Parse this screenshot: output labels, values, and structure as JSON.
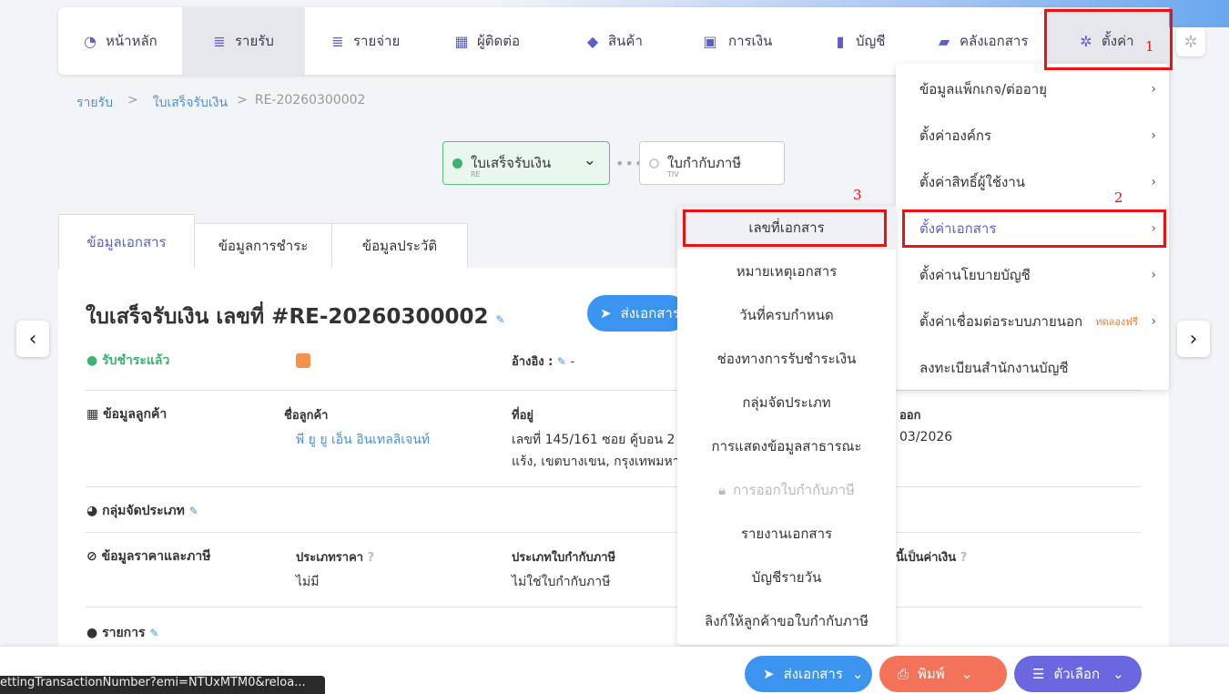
{
  "nav": {
    "items": [
      {
        "label": "หน้าหลัก",
        "icon": "dashboard-icon"
      },
      {
        "label": "รายรับ",
        "icon": "income-icon"
      },
      {
        "label": "รายจ่าย",
        "icon": "expense-icon"
      },
      {
        "label": "ผู้ติดต่อ",
        "icon": "building-icon"
      },
      {
        "label": "สินค้า",
        "icon": "box-icon"
      },
      {
        "label": "การเงิน",
        "icon": "money-icon"
      },
      {
        "label": "บัญชี",
        "icon": "book-icon"
      },
      {
        "label": "คลังเอกสาร",
        "icon": "folder-icon"
      },
      {
        "label": "ตั้งค่า",
        "icon": "gear-icon"
      }
    ]
  },
  "annotations": {
    "n1": "1",
    "n2": "2",
    "n3": "3"
  },
  "breadcrumb": {
    "c1": "รายรับ",
    "sep": ">",
    "c2": "ใบเสร็จรับเงิน",
    "c3": "RE-20260300002"
  },
  "flow": {
    "step1_title": "ใบเสร็จรับเงิน",
    "step1_sub": "RE",
    "step2_title": "ใบกำกับภาษี",
    "step2_sub": "TIV",
    "dots": "•••"
  },
  "tabs": [
    "ข้อมูลเอกสาร",
    "ข้อมูลการชำระ",
    "ข้อมูลประวัติ"
  ],
  "doc": {
    "title": "ใบเสร็จรับเงิน เลขที่ #RE-20260300002",
    "send_label": "ส่งเอกสาร",
    "status": "รับชำระแล้ว",
    "reference_label": "อ้างอิง :",
    "reference_value": "-",
    "customer_section": "ข้อมูลลูกค้า",
    "customer_name_label": "ชื่อลูกค้า",
    "customer_name": "พี ยู ยู เอ็น อินเทลลิเจนท์",
    "address_label": "ที่อยู่",
    "address_line1": "เลขที่ 145/161 ซอย คู้บอน 2",
    "address_line2": "แร้ง, เขตบางเขน, กรุงเทพมหา",
    "issue_date_label": "ออก",
    "issue_date": "03/2026",
    "category_section": "กลุ่มจัดประเภท",
    "price_section": "ข้อมูลราคาและภาษี",
    "price_type_label": "ประเภทราคา",
    "price_type_value": "ไม่มี",
    "tax_inv_type_label": "ประเภทใบกำกับภาษี",
    "tax_inv_type_value": "ไม่ใช่ใบกำกับภาษี",
    "currency_label": "นี้เป็นค่าเงิน",
    "items_section": "รายการ"
  },
  "settings_menu": [
    {
      "label": "ข้อมูลแพ็กเกจ/ต่ออายุ",
      "badge": ""
    },
    {
      "label": "ตั้งค่าองค์กร",
      "badge": ""
    },
    {
      "label": "ตั้งค่าสิทธิ์ผู้ใช้งาน",
      "badge": ""
    },
    {
      "label": "ตั้งค่าเอกสาร",
      "badge": ""
    },
    {
      "label": "ตั้งค่านโยบายบัญชี",
      "badge": ""
    },
    {
      "label": "ตั้งค่าเชื่อมต่อระบบภายนอก",
      "badge": "ทดลองฟรี"
    },
    {
      "label": "ลงทะเบียนสำนักงานบัญชี",
      "badge": ""
    }
  ],
  "doc_settings_menu": [
    "เลขที่เอกสาร",
    "หมายเหตุเอกสาร",
    "วันที่ครบกำหนด",
    "ช่องทางการรับชำระเงิน",
    "กลุ่มจัดประเภท",
    "การแสดงข้อมูลสาธารณะ",
    "การออกใบกำกับภาษี",
    "รายงานเอกสาร",
    "บัญชีรายวัน",
    "ลิงก์ให้ลูกค้าขอใบกำกับภาษี"
  ],
  "bottom": {
    "send": "ส่งเอกสาร",
    "print": "พิมพ์",
    "options": "ตัวเลือก"
  },
  "status_url": "ettingTransactionNumber?emi=NTUxMTM0&reloa...",
  "colors": {
    "accent": "#5b5fc7",
    "blue": "#3b95f0",
    "orange": "#f2735a",
    "purple": "#6b67e0",
    "success": "#3cb371",
    "red_annotation": "#ee1111"
  }
}
